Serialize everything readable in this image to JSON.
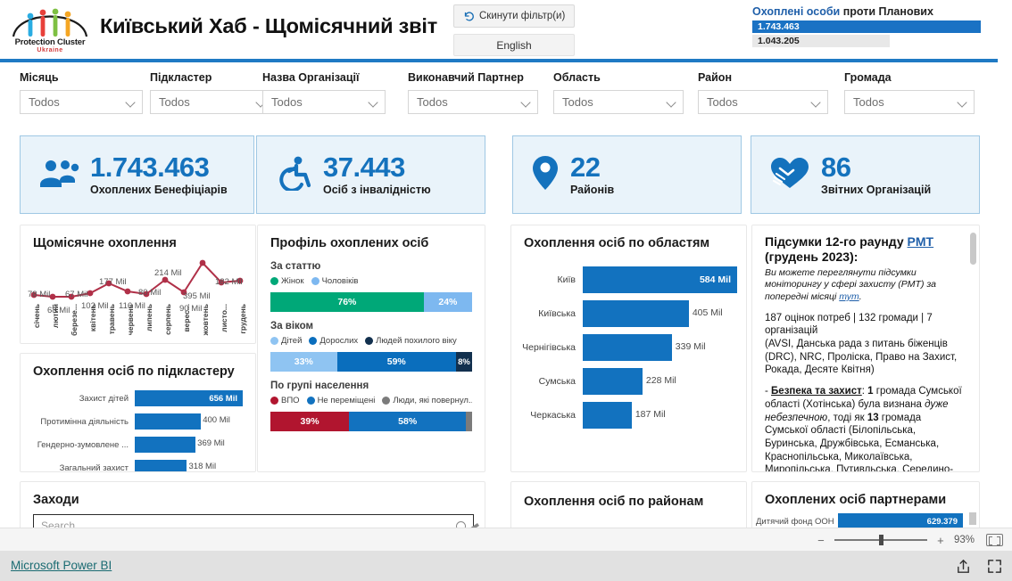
{
  "header": {
    "logo_caption": "Protection Cluster",
    "logo_sub": "Ukraine",
    "title": "Київський Хаб - Щомісячний звіт",
    "reset_button": "Скинути фільтр(и)",
    "language_button": "English",
    "comparison": {
      "title_highlight": "Охоплені особи",
      "title_rest": " проти Планових",
      "actual_value": "1.743.463",
      "target_value": "1.043.205"
    }
  },
  "filters": [
    {
      "label": "Місяць",
      "value": "Todos"
    },
    {
      "label": "Підкластер",
      "value": "Todos"
    },
    {
      "label": "Назва Організації",
      "value": "Todos"
    },
    {
      "label": "Виконавчий Партнер",
      "value": "Todos"
    },
    {
      "label": "Область",
      "value": "Todos"
    },
    {
      "label": "Район",
      "value": "Todos"
    },
    {
      "label": "Громада",
      "value": "Todos"
    }
  ],
  "kpis": [
    {
      "icon": "people-icon",
      "value": "1.743.463",
      "label": "Охоплених Бенефіціарів"
    },
    {
      "icon": "accessibility-icon",
      "value": "37.443",
      "label": "Осіб з інвалідністю"
    },
    {
      "icon": "map-pin-icon",
      "value": "22",
      "label": "Районів"
    },
    {
      "icon": "handshake-icon",
      "value": "86",
      "label": "Звітних Організацій"
    }
  ],
  "panels": {
    "monthly": {
      "title": "Щомісячне охоплення"
    },
    "subcluster": {
      "title": "Охоплення осіб по підкластеру"
    },
    "profile": {
      "title": "Профіль охоплених осіб",
      "sex_head": "За статтю",
      "age_head": "За віком",
      "pop_head": "По групі населення"
    },
    "regions": {
      "title": "Охоплення осіб по областям"
    },
    "rayons": {
      "title": "Охоплення осіб по районам"
    },
    "activities": {
      "title": "Заходи",
      "search_placeholder": "Search"
    },
    "partners": {
      "title": "Охоплених осіб партнерами"
    },
    "summary": {
      "heading_1": "Підсумки 12-го раунду ",
      "heading_link": "PMT",
      "heading_2": " (грудень 2023):",
      "italic_1": "Ви можете переглянути підсумки моніторингу у сфері захисту (PMT) за попередні місяці ",
      "italic_link": "тут",
      "italic_2": ".",
      "stats_line": "187 оцінок потреб | 132 громади | 7 організацій",
      "orgs_line": "(AVSI, Данська рада з питань біженців (DRC), NRC, Проліска, Право на Захист, Рокада, Десяте Квітня)",
      "bullet_label": "Безпека та захист",
      "bullet_body_1": ": ",
      "bullet_bold_1": "1",
      "bullet_body_2": " громада Сумської області (Хотінська) була визнана ",
      "bullet_italic": "дуже небезпечною",
      "bullet_body_3": ", тоді як ",
      "bullet_bold_2": "13",
      "bullet_body_4": " громада Сумської області (Білопільська, Буринська, Дружбівська, Есманська, Краснопільська, Миколаївська, Миропільська, Путивльська, Середино-Будська,"
    }
  },
  "chart_data": [
    {
      "type": "line",
      "title": "Щомісячне охоплення",
      "xlabel": "",
      "ylabel": "",
      "categories": [
        "січень",
        "лютий",
        "березе...",
        "квітень",
        "травень",
        "червень",
        "липень",
        "серпень",
        "верес...",
        "жовтень",
        "листо...",
        "грудень"
      ],
      "values": [
        78,
        68,
        67,
        102,
        177,
        116,
        80,
        214,
        90,
        395,
        182,
        190
      ],
      "value_labels": [
        "78 Mil",
        "68 Mil",
        "67 Mil",
        "102 Mil",
        "177 Mil",
        "116 Mil",
        "80 Mil",
        "214 Mil",
        "90 Mil",
        "395 Mil",
        "182 Mil",
        ""
      ],
      "unit": "Mil",
      "line_color": "#b03048",
      "grid": false,
      "legend": "none"
    },
    {
      "type": "bar",
      "orientation": "horizontal",
      "title": "Охоплення осіб по підкластеру",
      "categories": [
        "Захист дітей",
        "Протимінна діяльність",
        "Гендерно-зумовлене ...",
        "Загальний захист"
      ],
      "values": [
        656,
        400,
        369,
        318
      ],
      "value_labels": [
        "656 Mil",
        "400 Mil",
        "369 Mil",
        "318 Mil"
      ],
      "unit": "Mil",
      "bar_color": "#1272bf",
      "grid": false,
      "legend": "none"
    },
    {
      "type": "bar",
      "orientation": "stacked-horizontal",
      "title": "Профіль охоплених осіб — За статтю",
      "categories": [
        "Жінок",
        "Чоловіків"
      ],
      "values": [
        76,
        24
      ],
      "value_labels": [
        "76%",
        "24%"
      ],
      "colors": [
        "#00a878",
        "#7db8f0"
      ],
      "legend": "top"
    },
    {
      "type": "bar",
      "orientation": "stacked-horizontal",
      "title": "Профіль охоплених осіб — За віком",
      "categories": [
        "Дітей",
        "Дорослих",
        "Людей похилого віку"
      ],
      "values": [
        33,
        59,
        8
      ],
      "value_labels": [
        "33%",
        "59%",
        "8%"
      ],
      "colors": [
        "#8fc4f2",
        "#0a6ebd",
        "#12304e"
      ],
      "legend": "top"
    },
    {
      "type": "bar",
      "orientation": "stacked-horizontal",
      "title": "Профіль охоплених осіб — По групі населення",
      "categories": [
        "ВПО",
        "Не переміщені",
        "Люди, які повернул..."
      ],
      "values": [
        39,
        58,
        3
      ],
      "value_labels": [
        "39%",
        "58%",
        ""
      ],
      "colors": [
        "#b1152f",
        "#1272bf",
        "#7b7b7b"
      ],
      "legend": "top"
    },
    {
      "type": "bar",
      "orientation": "horizontal",
      "title": "Охоплення осіб по областям",
      "categories": [
        "Київ",
        "Київська",
        "Чернігівська",
        "Сумська",
        "Черкаська"
      ],
      "values": [
        584,
        405,
        339,
        228,
        187
      ],
      "value_labels": [
        "584 Mil",
        "405 Mil",
        "339 Mil",
        "228 Mil",
        "187 Mil"
      ],
      "unit": "Mil",
      "bar_color": "#1272bf",
      "grid": false,
      "legend": "none"
    },
    {
      "type": "bar",
      "orientation": "horizontal",
      "title": "Охоплених осіб партнерами",
      "categories": [
        "Дитячий фонд ООН"
      ],
      "values": [
        629379
      ],
      "value_labels": [
        "629.379"
      ],
      "bar_color": "#1272bf",
      "grid": false,
      "legend": "none"
    }
  ],
  "statusbar": {
    "zoom_level": "93%",
    "minus": "−",
    "plus": "+"
  },
  "footer": {
    "link": "Microsoft Power BI"
  }
}
